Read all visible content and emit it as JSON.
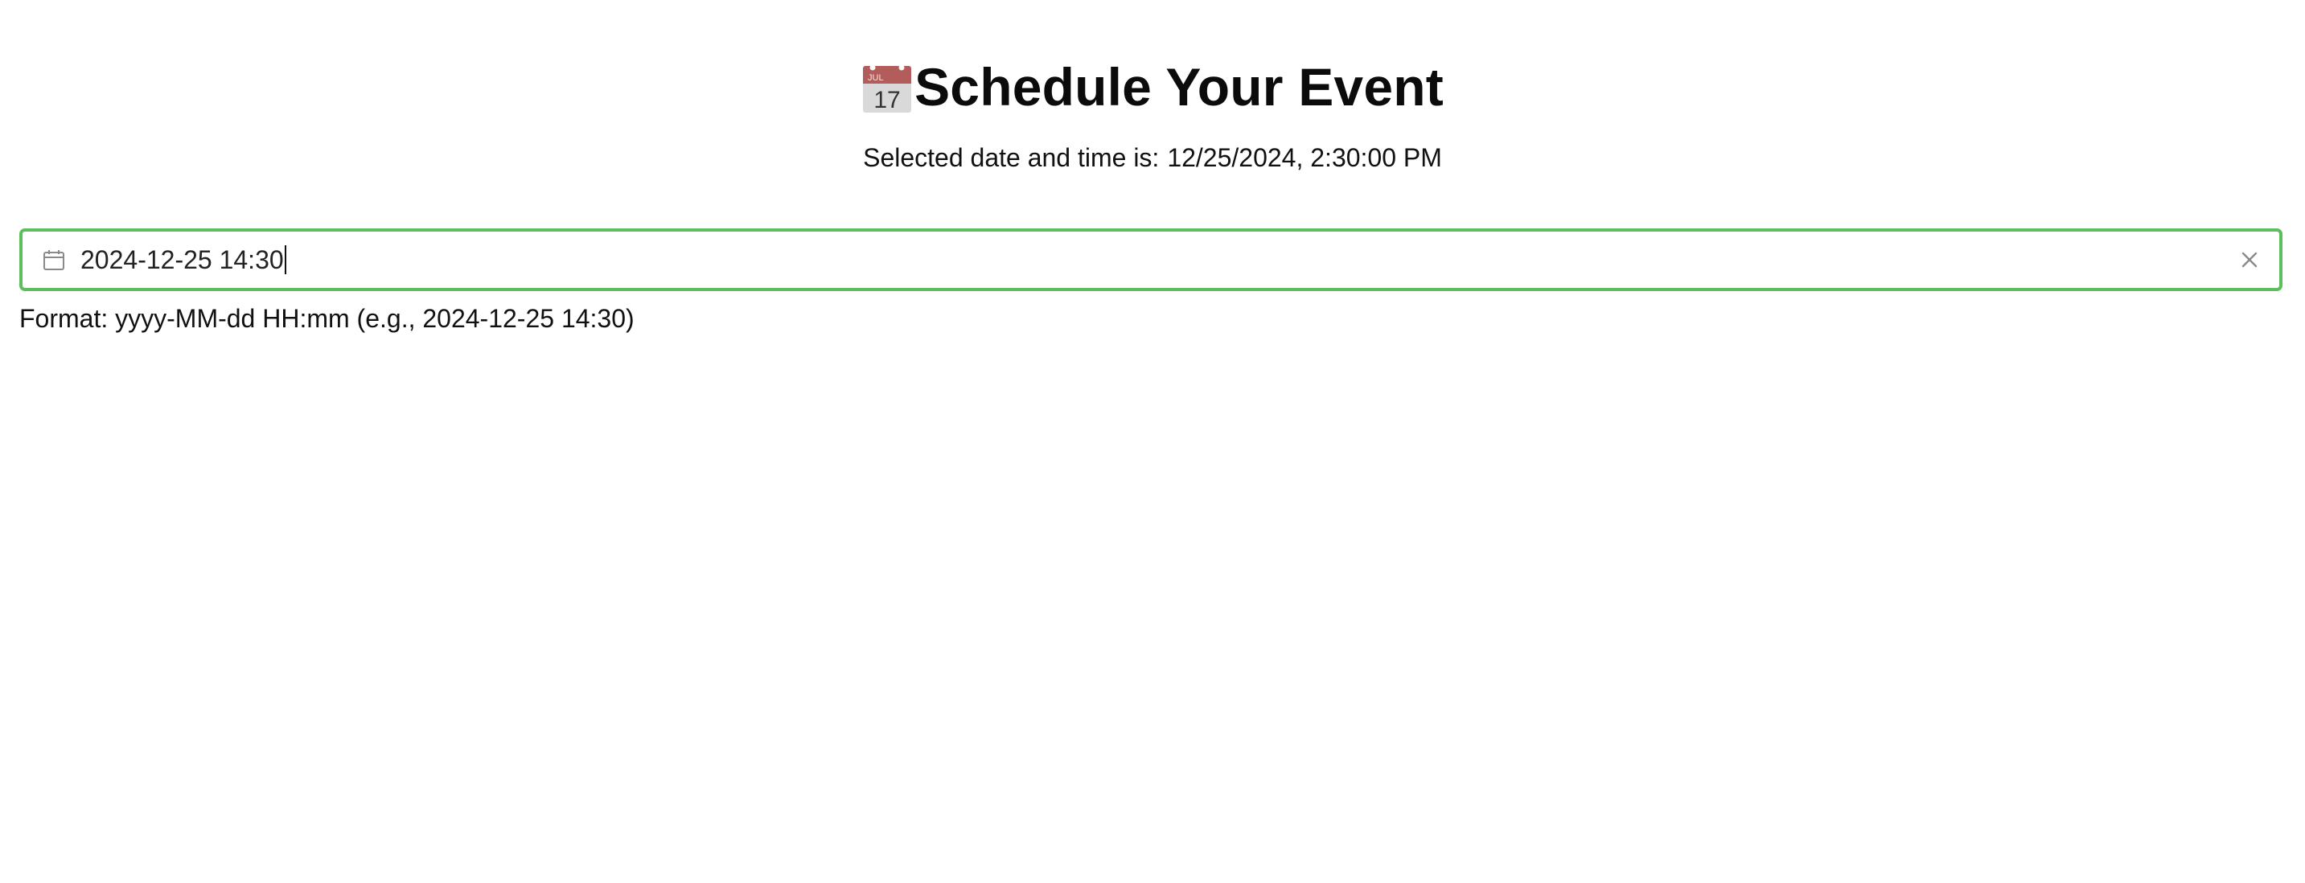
{
  "header": {
    "title": "Schedule Your Event",
    "emoji": {
      "icon": "calendar-emoji",
      "month": "JUL",
      "day": "17"
    }
  },
  "selection": {
    "label": "Selected date and time is:",
    "value": "12/25/2024, 2:30:00 PM"
  },
  "picker": {
    "value": "2024-12-25 14:30",
    "left_icon": "calendar-icon",
    "clear_icon": "close-icon",
    "border_color": "#5cbf5c"
  },
  "hint": {
    "text": "Format: yyyy-MM-dd HH:mm (e.g., 2024-12-25 14:30)"
  }
}
